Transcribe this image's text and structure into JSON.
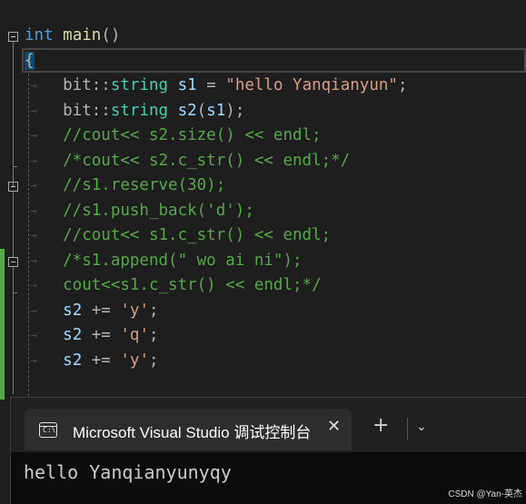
{
  "editor": {
    "lines": [
      {
        "parts": [
          [
            "kw",
            "int"
          ],
          [
            "op",
            " "
          ],
          [
            "fn",
            "main"
          ],
          [
            "op",
            "()"
          ]
        ]
      },
      {
        "parts": [
          [
            "op",
            "{"
          ]
        ]
      },
      {
        "parts": [
          [
            "op",
            "    bit::"
          ],
          [
            "ty",
            "string"
          ],
          [
            "op",
            " "
          ],
          [
            "var",
            "s1"
          ],
          [
            "op",
            " = "
          ],
          [
            "st",
            "\"hello Yanqianyun\""
          ],
          [
            "op",
            ";"
          ]
        ]
      },
      {
        "parts": [
          [
            "op",
            "    bit::"
          ],
          [
            "ty",
            "string"
          ],
          [
            "op",
            " "
          ],
          [
            "var",
            "s2"
          ],
          [
            "op",
            "("
          ],
          [
            "var",
            "s1"
          ],
          [
            "op",
            ");"
          ]
        ]
      },
      {
        "parts": [
          [
            "cm",
            "    //cout<< s2.size() << endl;"
          ]
        ]
      },
      {
        "parts": [
          [
            "cm",
            "    /*cout<< s2.c_str() << endl;*/"
          ]
        ]
      },
      {
        "parts": [
          [
            "cm",
            "    //s1.reserve(30);"
          ]
        ]
      },
      {
        "parts": [
          [
            "cm",
            "    //s1.push_back('d');"
          ]
        ]
      },
      {
        "parts": [
          [
            "cm",
            "    //cout<< s1.c_str() << endl;"
          ]
        ]
      },
      {
        "parts": [
          [
            "cm",
            "    /*s1.append(\" wo ai ni\");"
          ]
        ]
      },
      {
        "parts": [
          [
            "cm",
            "    cout<<s1.c_str() << endl;*/"
          ]
        ]
      },
      {
        "parts": [
          [
            "op",
            "    "
          ],
          [
            "var",
            "s2"
          ],
          [
            "op",
            " += "
          ],
          [
            "st",
            "'y'"
          ],
          [
            "op",
            ";"
          ]
        ]
      },
      {
        "parts": [
          [
            "op",
            "    "
          ],
          [
            "var",
            "s2"
          ],
          [
            "op",
            " += "
          ],
          [
            "st",
            "'q'"
          ],
          [
            "op",
            ";"
          ]
        ]
      },
      {
        "parts": [
          [
            "op",
            "    "
          ],
          [
            "var",
            "s2"
          ],
          [
            "op",
            " += "
          ],
          [
            "st",
            "'y'"
          ],
          [
            "op",
            ";"
          ]
        ]
      }
    ]
  },
  "console": {
    "tab_title": "Microsoft Visual Studio 调试控制台",
    "tab_icon_text": "C:\\",
    "close_glyph": "✕",
    "new_tab_glyph": "+",
    "dropdown_glyph": "⌄",
    "output": "hello Yanqianyunyqy"
  },
  "watermark": "CSDN @Yan-英杰"
}
